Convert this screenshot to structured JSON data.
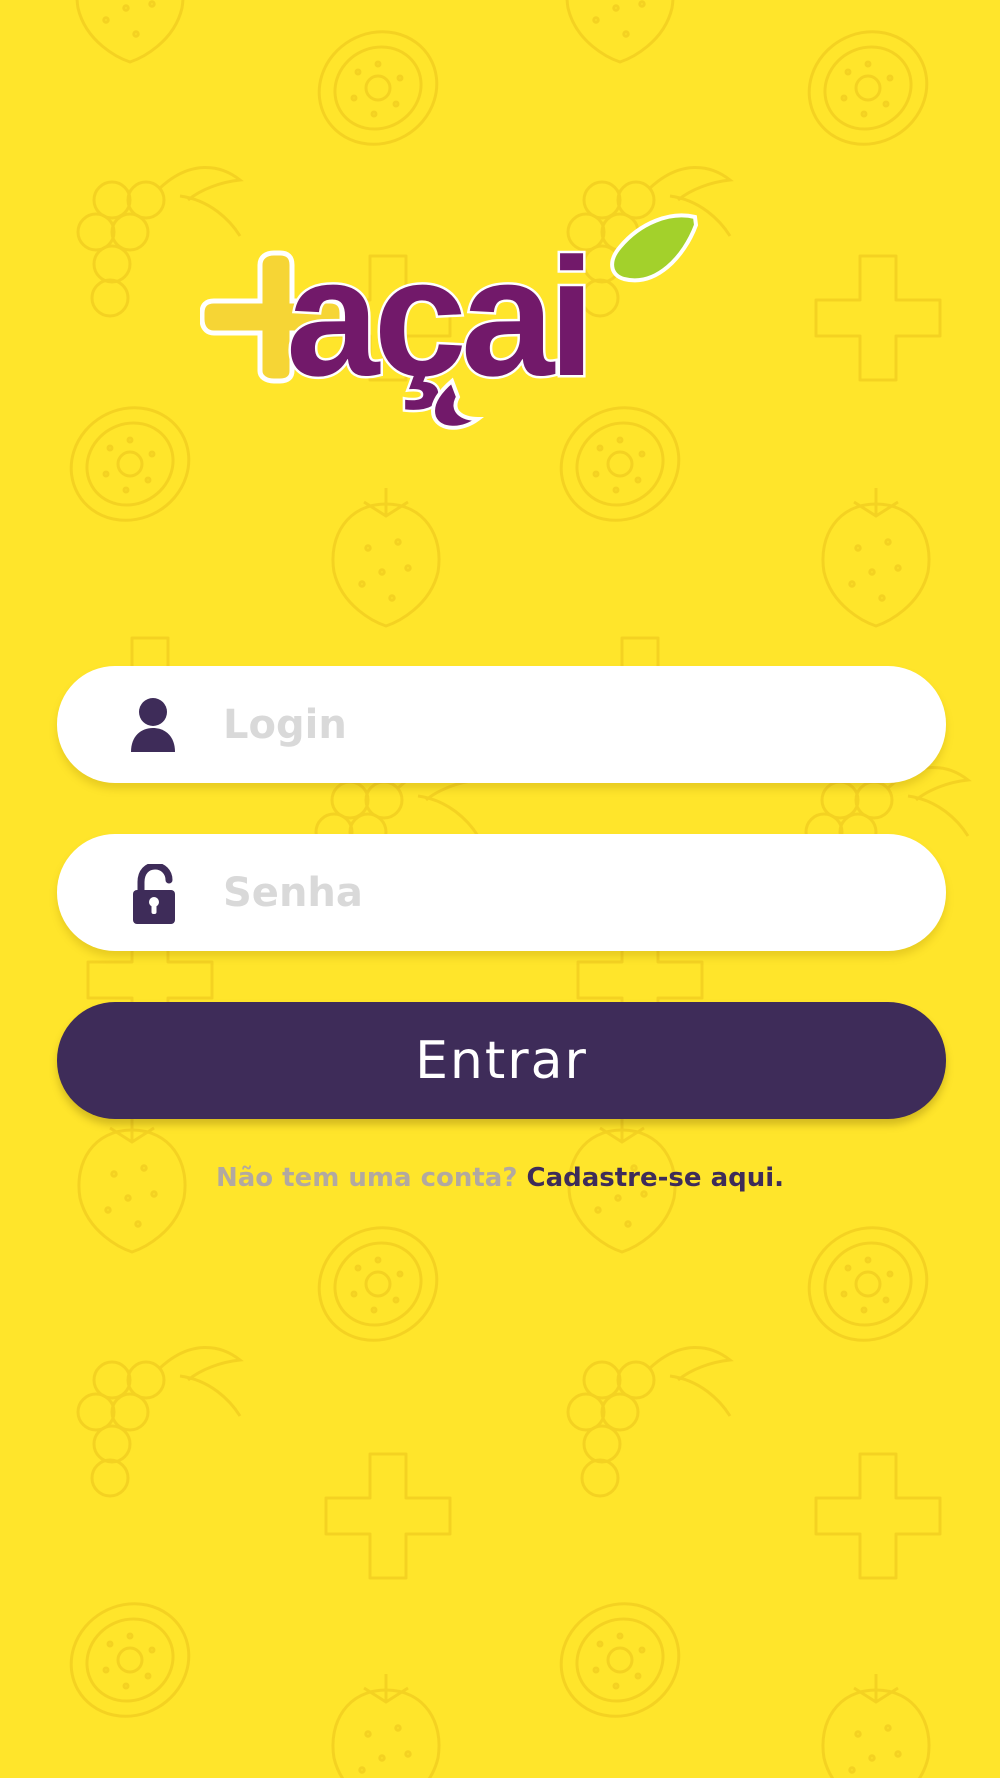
{
  "logo": {
    "text": "+açaí"
  },
  "login": {
    "placeholder": "Login",
    "value": ""
  },
  "password": {
    "placeholder": "Senha",
    "value": ""
  },
  "submit": {
    "label": "Entrar"
  },
  "signup": {
    "question": "Não tem uma conta?",
    "link": "Cadastre-se aqui."
  },
  "colors": {
    "background": "#ffe52b",
    "brand_purple": "#72196a",
    "button": "#3e2c59",
    "leaf_green": "#a3d12b"
  },
  "icons": {
    "login": "user-icon",
    "password": "lock-icon"
  }
}
